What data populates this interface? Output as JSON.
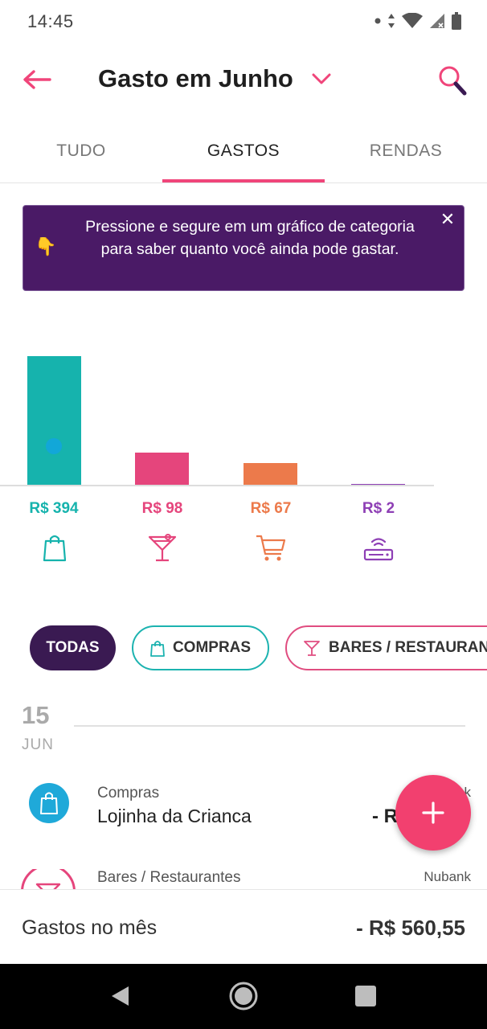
{
  "status_bar": {
    "time": "14:45",
    "icons": [
      "notification-dot-icon",
      "data-arrows-icon",
      "wifi-icon",
      "signal-icon",
      "battery-icon"
    ]
  },
  "header": {
    "title": "Gasto em Junho",
    "back_icon": "arrow-left-icon",
    "dropdown_icon": "chevron-down-icon",
    "search_icon": "search-icon"
  },
  "tabs": [
    {
      "label": "TUDO",
      "active": false
    },
    {
      "label": "GASTOS",
      "active": true
    },
    {
      "label": "RENDAS",
      "active": false
    }
  ],
  "tip": {
    "icon": "pointing-down-hand-icon",
    "text": "Pressione e segure em um gráfico de categoria para saber quanto você ainda pode gastar.",
    "close_icon": "close-icon"
  },
  "chart_data": {
    "type": "bar",
    "categories": [
      "Compras",
      "Bares / Restaurantes",
      "Mercado",
      "Serviços"
    ],
    "values": [
      394,
      98,
      67,
      2
    ],
    "value_labels": [
      "R$ 394",
      "R$ 98",
      "R$ 67",
      "R$ 2"
    ],
    "colors": [
      "#16b3ad",
      "#e5457c",
      "#ec7a4b",
      "#8e3fb5"
    ],
    "icons": [
      "shopping-bag-icon",
      "cocktail-icon",
      "shopping-cart-icon",
      "router-icon"
    ],
    "ylim": [
      0,
      394
    ]
  },
  "filters": [
    {
      "label": "TODAS",
      "icon": "",
      "selected": true
    },
    {
      "label": "COMPRAS",
      "icon": "shopping-bag-icon",
      "selected": false
    },
    {
      "label": "BARES / RESTAURAN",
      "icon": "cocktail-icon",
      "selected": false
    }
  ],
  "date_group": {
    "day": "15",
    "month": "JUN"
  },
  "transactions": [
    {
      "category": "Compras",
      "name": "Lojinha da Crianca",
      "bank": "k",
      "amount": "- R",
      "icon": "shopping-bag-icon",
      "color": "#1fa9d9"
    },
    {
      "category": "Bares / Restaurantes",
      "name": "",
      "bank": "Nubank",
      "amount": "",
      "icon": "cocktail-icon",
      "color": "#e5457c"
    }
  ],
  "fab": {
    "icon": "plus-icon"
  },
  "footer": {
    "label": "Gastos no mês",
    "value": "- R$ 560,55"
  },
  "nav_bar": {
    "icons": [
      "back-triangle-icon",
      "home-circle-icon",
      "recents-square-icon"
    ]
  }
}
